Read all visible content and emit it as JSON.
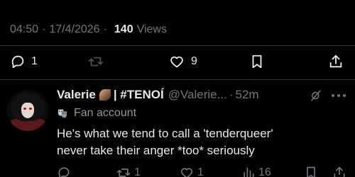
{
  "post": {
    "time": "04:50",
    "date": "17/4/2026",
    "separator": "·",
    "views_count": "140",
    "views_label": "Views"
  },
  "post_actions": {
    "reply_count": "1",
    "retweet_count": "",
    "like_count": "9"
  },
  "reply": {
    "display_name": "Valerie",
    "name_suffix": "| #TENOÍ",
    "handle": "@Valerie...",
    "dot": "·",
    "time": "52m",
    "fan_label": "Fan account",
    "text_line1": "He's what we tend to call a 'tenderqueer'",
    "text_line2": "never take their anger *too* seriously",
    "actions": {
      "reply_count": "",
      "retweet_count": "1",
      "like_count": "1",
      "views_count": "16"
    }
  },
  "colors": {
    "background": "#000000",
    "text": "#e7e9ea",
    "secondary": "#71767b",
    "divider": "#2f3336"
  }
}
